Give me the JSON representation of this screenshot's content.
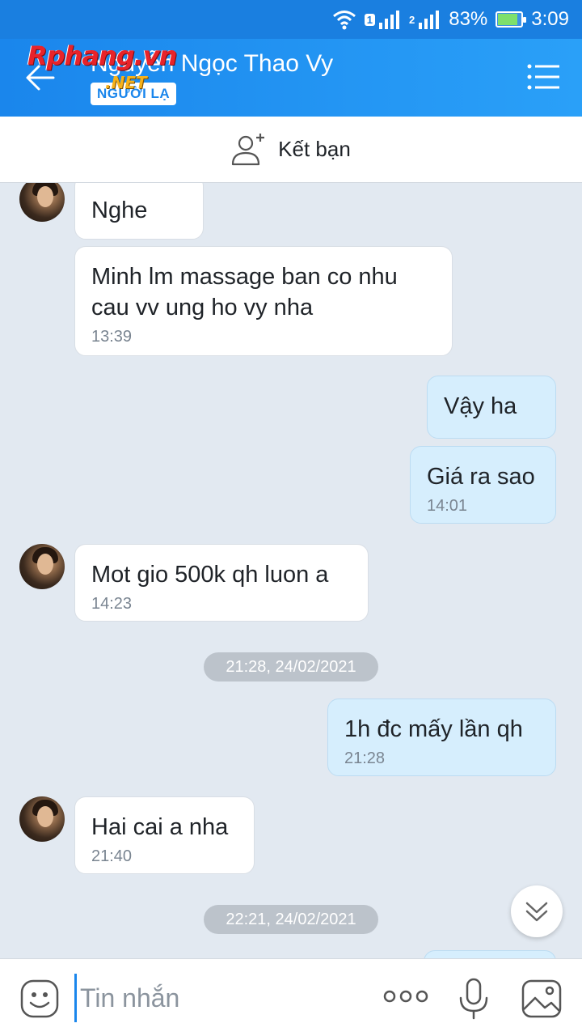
{
  "status_bar": {
    "sim1": "1",
    "sim2": "2",
    "battery_percent": "83%",
    "battery_level": 0.83,
    "time": "3:09"
  },
  "header": {
    "title": "Nguyễn Ngọc Thao Vy",
    "badge": "NGƯỜI LẠ",
    "watermark": "Rphang.vn",
    "watermark_sub": ".NET"
  },
  "friend_bar": {
    "label": "Kết bạn"
  },
  "messages": [
    {
      "side": "in",
      "text": "Nghe",
      "time": ""
    },
    {
      "side": "in",
      "text": "Minh lm massage ban co nhu cau vv ung ho vy nha",
      "time": "13:39"
    },
    {
      "side": "out",
      "text": "Vậy ha",
      "time": ""
    },
    {
      "side": "out",
      "text": "Giá ra sao",
      "time": "14:01"
    },
    {
      "side": "in",
      "text": "Mot gio 500k qh luon a",
      "time": "14:23"
    },
    {
      "side": "date",
      "text": "21:28, 24/02/2021"
    },
    {
      "side": "out",
      "text": "1h đc mấy lần qh",
      "time": "21:28"
    },
    {
      "side": "in",
      "text": "Hai cai a nha",
      "time": "21:40"
    },
    {
      "side": "date",
      "text": "22:21, 24/02/2021"
    }
  ],
  "input": {
    "placeholder": "Tin nhắn"
  },
  "colors": {
    "header": "#1a86ec",
    "outgoing_bubble": "#d6eefd",
    "incoming_bubble": "#ffffff",
    "background": "#e2e9f1"
  },
  "icons": {
    "back": "arrow-left-icon",
    "menu": "list-menu-icon",
    "add_friend": "add-user-icon",
    "emoji": "emoji-icon",
    "more": "more-dots-icon",
    "voice": "microphone-icon",
    "image": "image-icon",
    "scroll_down": "double-chevron-down-icon"
  }
}
